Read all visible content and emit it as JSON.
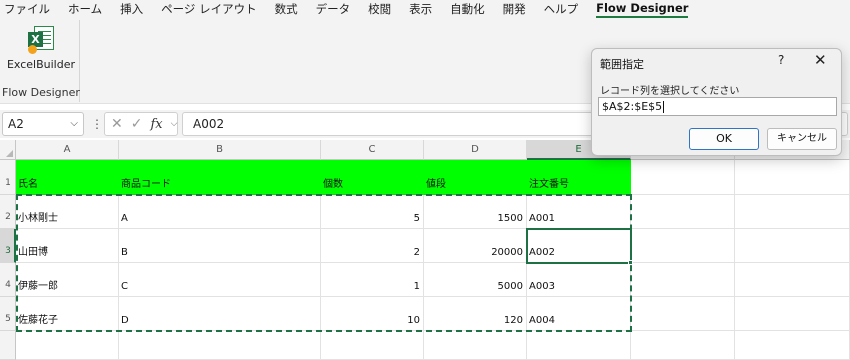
{
  "menu": {
    "items": [
      "ファイル",
      "ホーム",
      "挿入",
      "ページ レイアウト",
      "数式",
      "データ",
      "校閲",
      "表示",
      "自動化",
      "開発",
      "ヘルプ",
      "Flow Designer"
    ]
  },
  "ribbon": {
    "button_label": "ExcelBuilder",
    "group_label": "Flow Designer",
    "icon": "excel-builder-icon"
  },
  "formula_bar": {
    "name_box": "A2",
    "formula": "A002",
    "icons": [
      "cancel-x-icon",
      "enter-check-icon",
      "fx-icon"
    ]
  },
  "sheet": {
    "columns": [
      "A",
      "B",
      "C",
      "D",
      "E"
    ],
    "selected_column": "E",
    "selected_row": "3",
    "header_fill": "#00ff00",
    "rows": [
      {
        "num": "1",
        "cells": [
          "氏名",
          "商品コード",
          "個数",
          "値段",
          "注文番号"
        ]
      },
      {
        "num": "2",
        "cells": [
          "小林剛士",
          "A",
          "5",
          "1500",
          "A001"
        ]
      },
      {
        "num": "3",
        "cells": [
          "山田博",
          "B",
          "2",
          "20000",
          "A002"
        ]
      },
      {
        "num": "4",
        "cells": [
          "伊藤一郎",
          "C",
          "1",
          "5000",
          "A003"
        ]
      },
      {
        "num": "5",
        "cells": [
          "佐藤花子",
          "D",
          "10",
          "120",
          "A004"
        ]
      }
    ]
  },
  "dialog": {
    "title": "範囲指定",
    "help": "?",
    "close": "✕",
    "label": "レコード列を選択してください",
    "value": "$A$2:$E$5",
    "ok_label": "OK",
    "cancel_label": "キャンセル"
  },
  "colors": {
    "accent": "#1e7145",
    "dialog_ok_border": "#2f74c5"
  }
}
